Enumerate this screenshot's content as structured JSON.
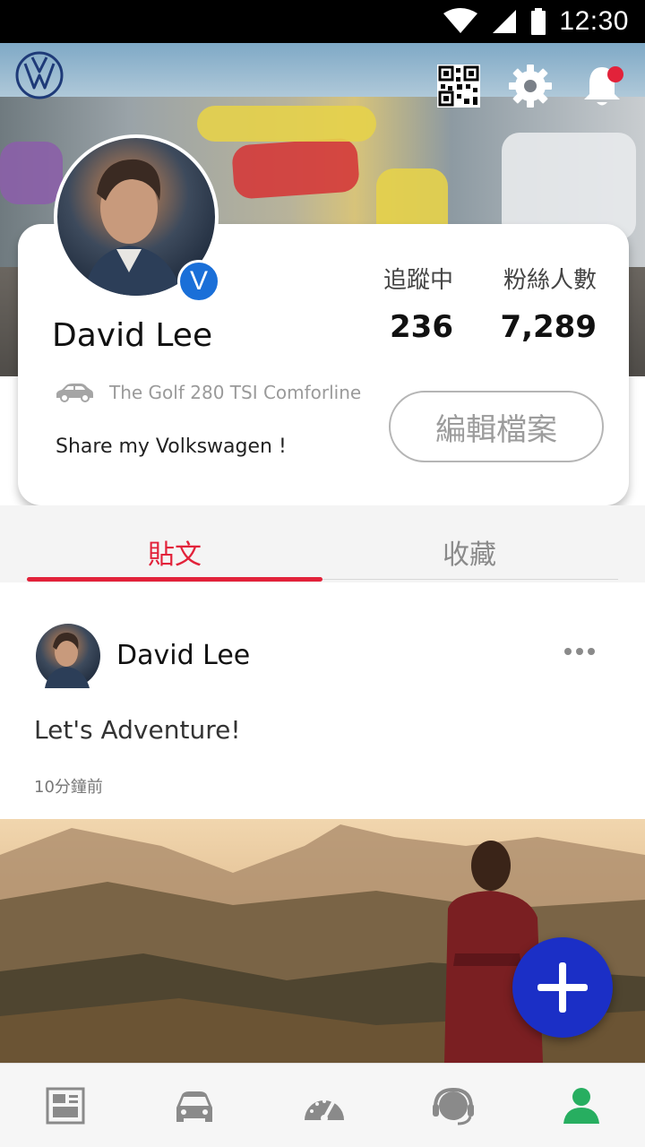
{
  "status_bar": {
    "time": "12:30",
    "icons": [
      "wifi-icon",
      "signal-icon",
      "battery-icon"
    ]
  },
  "header": {
    "logo": "vw-logo",
    "actions": [
      "qr-code-icon",
      "gear-icon",
      "bell-icon"
    ],
    "has_notification": true
  },
  "profile": {
    "name": "David Lee",
    "verified_badge": "V",
    "car_model": "The Golf 280 TSI Comforline",
    "bio": "Share my Volkswagen !",
    "following_label": "追蹤中",
    "following_count": "236",
    "followers_label": "粉絲人數",
    "followers_count": "7,289",
    "edit_button": "編輯檔案"
  },
  "tabs": [
    {
      "label": "貼文",
      "active": true
    },
    {
      "label": "收藏",
      "active": false
    }
  ],
  "post": {
    "author": "David Lee",
    "text": "Let's Adventure!",
    "time": "10分鐘前"
  },
  "bottom_nav": [
    {
      "icon": "news-icon",
      "active": false
    },
    {
      "icon": "car-icon",
      "active": false
    },
    {
      "icon": "dashboard-icon",
      "active": false
    },
    {
      "icon": "support-headset-icon",
      "active": false
    },
    {
      "icon": "profile-icon",
      "active": true
    }
  ],
  "colors": {
    "accent_red": "#e2223a",
    "fab_blue": "#1b2fc6",
    "verified_blue": "#1a6fd8",
    "active_green": "#27ae60",
    "nav_gray": "#8a8a8a"
  }
}
